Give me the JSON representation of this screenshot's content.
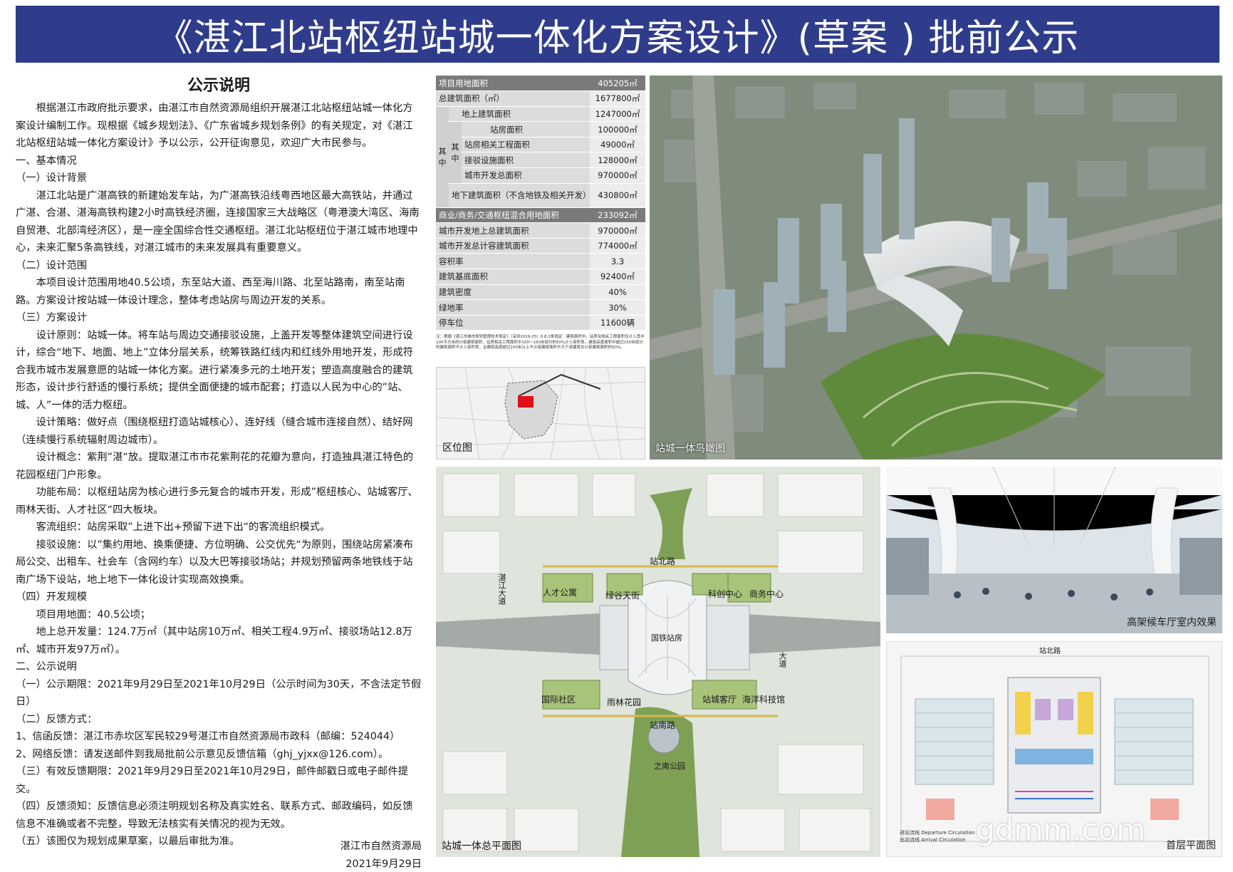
{
  "title": "《湛江北站枢纽站城一体化方案设计》(草案 ) 批前公示",
  "notice": {
    "heading": "公示说明",
    "intro": "根据湛江市政府批示要求，由湛江市自然资源局组织开展湛江北站枢纽站城一体化方案设计编制工作。现根据《城乡规划法》、《广东省城乡规划条例》的有关规定，对《湛江北站枢纽站城一体化方案设计》予以公示，公开征询意见，欢迎广大市民参与。",
    "s1": "一、基本情况",
    "s1_1": "（一）设计背景",
    "s1_1_text": "湛江北站是广湛高铁的新建始发车站，为广湛高铁沿线粤西地区最大高铁站，并通过广湛、合湛、湛海高铁构建2小时高铁经济圈，连接国家三大战略区（粤港澳大湾区、海南自贸港、北部湾经济区），是一座全国综合性交通枢纽。湛江北站枢纽位于湛江城市地理中心，未来汇聚5条高铁线，对湛江城市的未来发展具有重要意义。",
    "s1_2": "（二）设计范围",
    "s1_2_text": "本项目设计范围用地40.5公顷，东至站大道、西至海川路、北至站路南，南至站南路。方案设计按站城一体设计理念，整体考虑站房与周边开发的关系。",
    "s1_3": "（三）方案设计",
    "p_principle": "设计原则：站城一体。将车站与周边交通接驳设施，上盖开发等整体建筑空间进行设计，综合“地下、地面、地上”立体分层关系，统筹铁路红线内和红线外用地开发，形成符合我市城市发展意愿的站城一体化方案。进行紧凑多元的土地开发；塑造高度融合的建筑形态，设计步行舒适的慢行系统；提供全面便捷的城市配套；打造以人民为中心的”站、城、人”一体的活力枢纽。",
    "p_strategy": "设计策略：做好点（围绕枢纽打造站城核心）、连好线（缝合城市连接自然）、结好网（连续慢行系统辐射周边城市）。",
    "p_concept": "设计概念：紫荆”湛“放。提取湛江市市花紫荆花的花瓣为意向，打造独具湛江特色的花园枢纽门户形象。",
    "p_layout": "功能布局：以枢纽站房为核心进行多元复合的城市开发，形成”枢纽核心、站城客厅、雨林天街、人才社区“四大板块。",
    "p_flow": "客流组织：站房采取”上进下出+预留下进下出“的客流组织模式。",
    "p_transfer": "接驳设施：以”集约用地、换乘便捷、方位明确、公交优先“为原则，围绕站房紧凑布局公交、出租车、社会车（含网约车）以及大巴等接驳场站；并规划预留两条地铁线于站南广场下设站，地上地下一体化设计实现高效换乘。",
    "s1_4": "（四）开发规模",
    "p_area": "项目用地面：40.5公顷；",
    "p_total": "地上总开发量：124.7万㎡（其中站房10万㎡、相关工程4.9万㎡、接驳场站12.8万㎡、城市开发97万㎡）。",
    "s2": "二、公示说明",
    "s2_1": "（一）公示期限：2021年9月29日至2021年10月29日（公示时间为30天，不含法定节假日）",
    "s2_2": "（二）反馈方式：",
    "s2_2_a": "1、信函反馈：湛江市赤坎区军民较29号湛江市自然资源局市政科（邮编：524044）",
    "s2_2_b": "2、网络反馈：请发送邮件到我局批前公示意见反馈信箱（ghj_yjxx@126.com）。",
    "s2_3": "（三）有效反馈期限：2021年9月29日至2021年10月29日，邮件邮戳日或电子邮件提交。",
    "s2_4": "（四）反馈须知：反馈信息必须注明规划名称及真实姓名、联系方式、邮政编码，如反馈信息不准确或者不完整，导致无法核实有关情况的视为无效。",
    "s2_5": "（五）该图仅为规划成果草案，以最后审批为准。",
    "org": "湛江市自然资源局",
    "date": "2021年9月29日"
  },
  "stats": {
    "r0": {
      "label": "项目用地面积",
      "value": "405205㎡"
    },
    "r1": {
      "label": "总建筑面积（㎡）",
      "value": "1677800㎡"
    },
    "r2": {
      "label": "地上建筑面积",
      "value": "1247000㎡"
    },
    "r3": {
      "label": "站房面积",
      "value": "100000㎡"
    },
    "r4": {
      "label": "站房相关工程面积",
      "value": "49000㎡"
    },
    "r5": {
      "label": "接驳设施面积",
      "value": "128000㎡"
    },
    "r6": {
      "label": "城市开发总面积",
      "value": "970000㎡"
    },
    "r7": {
      "label": "地下建筑面积（不含地铁及相关开发）",
      "value": "430800㎡"
    },
    "r8": {
      "label": "商业/商务/交通枢纽混合用地面积",
      "value": "233092㎡"
    },
    "r9": {
      "label": "城市开发地上总建筑面积",
      "value": "970000㎡"
    },
    "r10": {
      "label": "城市开发总计容建筑面积",
      "value": "774000㎡"
    },
    "r11": {
      "label": "容积率",
      "value": "3.3"
    },
    "r12": {
      "label": "建筑基底面积",
      "value": "92400㎡"
    },
    "r13": {
      "label": "建筑密度",
      "value": "40%"
    },
    "r14": {
      "label": "绿地率",
      "value": "30%"
    },
    "r15": {
      "label": "停车位",
      "value": "11600辆"
    },
    "group_outer": "其中",
    "group_inner": "其中",
    "note": "注：根据《湛江市城市规划管理技术规定》（深圳2019-25）6.8.2条规定：建筑面积中，站房及相关工程面积仅计入其中100平方米的计容建筑面积，站房相关工程面积中100～150米部分的50%计入容积率，建筑高度面积中超过150米部分的建筑面积不计入容积率，且建筑高度超过150米以上不计容建筑面积不大于该建筑总计容建筑面积的50%。"
  },
  "captions": {
    "location": "区位图",
    "aerial": "站城一体鸟瞰图",
    "plan": "站城一体总平面图",
    "interior": "高架候车厅室内效果",
    "floor": "首层平面图"
  },
  "plan_labels": {
    "rencai": "人才公寓",
    "lvgu": "绿谷天街",
    "kechuang": "科创中心",
    "shangwu": "商务中心",
    "guoji": "国际社区",
    "yulin": "雨林花园",
    "zhancheng": "站城客厅",
    "haiyang": "海洋科技馆",
    "guotie": "国铁站房",
    "zhinan": "之南公园",
    "zhan_bei": "站北路",
    "zhan_nan": "站南路",
    "ditu_road": "湛江大道",
    "da_road": "大道"
  },
  "floor_labels": {
    "road": "站北路",
    "legend1": "进站流线 Departure Circulation",
    "legend2": "出站流线 Arrival Circulation"
  },
  "watermark": "gdmm.com"
}
